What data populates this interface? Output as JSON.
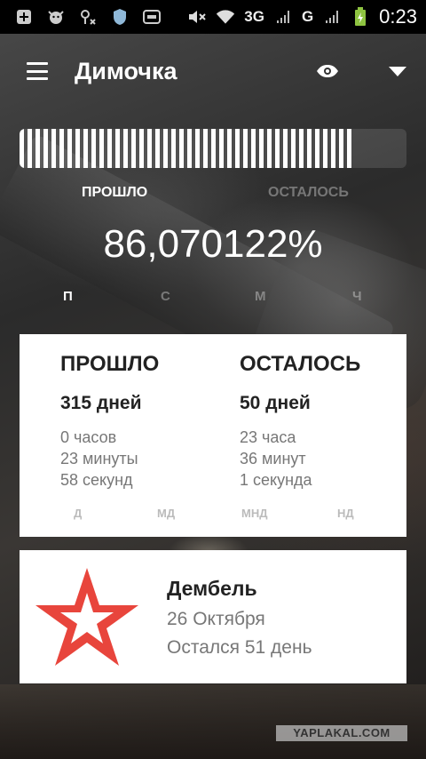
{
  "status_bar": {
    "network_1": "3G",
    "network_2": "G",
    "time": "0:23",
    "icons": [
      "add-box-icon",
      "cow-icon",
      "location-icon",
      "shield-icon",
      "card-icon",
      "mute-icon",
      "wifi-icon",
      "signal-icon",
      "signal-icon",
      "battery-charging-icon"
    ]
  },
  "toolbar": {
    "title": "Димочка",
    "icons": [
      "menu-icon",
      "eye-icon",
      "dropdown-icon"
    ]
  },
  "progress": {
    "fraction": 0.8607,
    "tab_passed": "ПРОШЛО",
    "tab_left": "ОСТАЛОСЬ",
    "percent_text": "86,070122%",
    "units": [
      "П",
      "С",
      "М",
      "Ч"
    ]
  },
  "stats": {
    "passed": {
      "heading": "ПРОШЛО",
      "days": "315 дней",
      "hours": "0 часов",
      "minutes": "23 минуты",
      "seconds": "58 секунд"
    },
    "remaining": {
      "heading": "ОСТАЛОСЬ",
      "days": "50 дней",
      "hours": "23 часа",
      "minutes": "36 минут",
      "seconds": "1 секунда"
    },
    "units": [
      "Д",
      "МД",
      "МНД",
      "НД"
    ]
  },
  "event": {
    "title": "Дембель",
    "date": "26 Октября",
    "left": "Остался 51 день",
    "star_color": "#e8453c"
  },
  "watermark": "YAPLAKAL.COM"
}
